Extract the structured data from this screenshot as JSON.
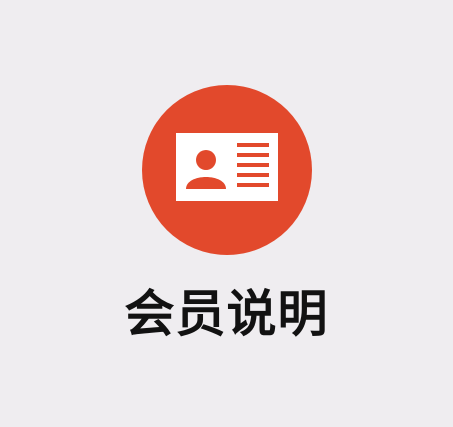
{
  "tile": {
    "label": "会员说明",
    "icon": "member-card-icon",
    "accent_color": "#e2492c",
    "icon_foreground_color": "#ffffff",
    "background_color": "#efedf0",
    "text_color": "#121212"
  }
}
